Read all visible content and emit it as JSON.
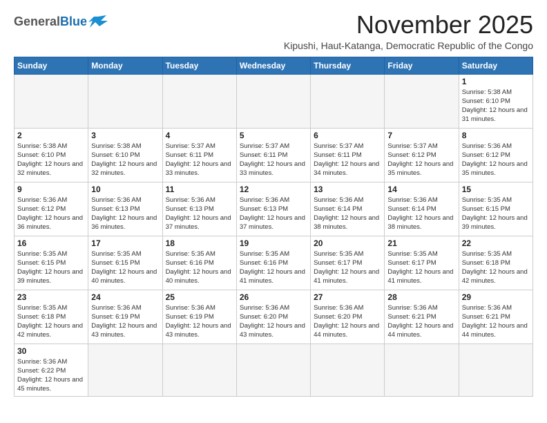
{
  "header": {
    "logo_general": "General",
    "logo_blue": "Blue",
    "month_title": "November 2025",
    "subtitle": "Kipushi, Haut-Katanga, Democratic Republic of the Congo"
  },
  "days_of_week": [
    "Sunday",
    "Monday",
    "Tuesday",
    "Wednesday",
    "Thursday",
    "Friday",
    "Saturday"
  ],
  "weeks": [
    [
      {
        "day": "",
        "info": ""
      },
      {
        "day": "",
        "info": ""
      },
      {
        "day": "",
        "info": ""
      },
      {
        "day": "",
        "info": ""
      },
      {
        "day": "",
        "info": ""
      },
      {
        "day": "",
        "info": ""
      },
      {
        "day": "1",
        "info": "Sunrise: 5:38 AM\nSunset: 6:10 PM\nDaylight: 12 hours and 31 minutes."
      }
    ],
    [
      {
        "day": "2",
        "info": "Sunrise: 5:38 AM\nSunset: 6:10 PM\nDaylight: 12 hours and 32 minutes."
      },
      {
        "day": "3",
        "info": "Sunrise: 5:38 AM\nSunset: 6:10 PM\nDaylight: 12 hours and 32 minutes."
      },
      {
        "day": "4",
        "info": "Sunrise: 5:37 AM\nSunset: 6:11 PM\nDaylight: 12 hours and 33 minutes."
      },
      {
        "day": "5",
        "info": "Sunrise: 5:37 AM\nSunset: 6:11 PM\nDaylight: 12 hours and 33 minutes."
      },
      {
        "day": "6",
        "info": "Sunrise: 5:37 AM\nSunset: 6:11 PM\nDaylight: 12 hours and 34 minutes."
      },
      {
        "day": "7",
        "info": "Sunrise: 5:37 AM\nSunset: 6:12 PM\nDaylight: 12 hours and 35 minutes."
      },
      {
        "day": "8",
        "info": "Sunrise: 5:36 AM\nSunset: 6:12 PM\nDaylight: 12 hours and 35 minutes."
      }
    ],
    [
      {
        "day": "9",
        "info": "Sunrise: 5:36 AM\nSunset: 6:12 PM\nDaylight: 12 hours and 36 minutes."
      },
      {
        "day": "10",
        "info": "Sunrise: 5:36 AM\nSunset: 6:13 PM\nDaylight: 12 hours and 36 minutes."
      },
      {
        "day": "11",
        "info": "Sunrise: 5:36 AM\nSunset: 6:13 PM\nDaylight: 12 hours and 37 minutes."
      },
      {
        "day": "12",
        "info": "Sunrise: 5:36 AM\nSunset: 6:13 PM\nDaylight: 12 hours and 37 minutes."
      },
      {
        "day": "13",
        "info": "Sunrise: 5:36 AM\nSunset: 6:14 PM\nDaylight: 12 hours and 38 minutes."
      },
      {
        "day": "14",
        "info": "Sunrise: 5:36 AM\nSunset: 6:14 PM\nDaylight: 12 hours and 38 minutes."
      },
      {
        "day": "15",
        "info": "Sunrise: 5:35 AM\nSunset: 6:15 PM\nDaylight: 12 hours and 39 minutes."
      }
    ],
    [
      {
        "day": "16",
        "info": "Sunrise: 5:35 AM\nSunset: 6:15 PM\nDaylight: 12 hours and 39 minutes."
      },
      {
        "day": "17",
        "info": "Sunrise: 5:35 AM\nSunset: 6:15 PM\nDaylight: 12 hours and 40 minutes."
      },
      {
        "day": "18",
        "info": "Sunrise: 5:35 AM\nSunset: 6:16 PM\nDaylight: 12 hours and 40 minutes."
      },
      {
        "day": "19",
        "info": "Sunrise: 5:35 AM\nSunset: 6:16 PM\nDaylight: 12 hours and 41 minutes."
      },
      {
        "day": "20",
        "info": "Sunrise: 5:35 AM\nSunset: 6:17 PM\nDaylight: 12 hours and 41 minutes."
      },
      {
        "day": "21",
        "info": "Sunrise: 5:35 AM\nSunset: 6:17 PM\nDaylight: 12 hours and 41 minutes."
      },
      {
        "day": "22",
        "info": "Sunrise: 5:35 AM\nSunset: 6:18 PM\nDaylight: 12 hours and 42 minutes."
      }
    ],
    [
      {
        "day": "23",
        "info": "Sunrise: 5:35 AM\nSunset: 6:18 PM\nDaylight: 12 hours and 42 minutes."
      },
      {
        "day": "24",
        "info": "Sunrise: 5:36 AM\nSunset: 6:19 PM\nDaylight: 12 hours and 43 minutes."
      },
      {
        "day": "25",
        "info": "Sunrise: 5:36 AM\nSunset: 6:19 PM\nDaylight: 12 hours and 43 minutes."
      },
      {
        "day": "26",
        "info": "Sunrise: 5:36 AM\nSunset: 6:20 PM\nDaylight: 12 hours and 43 minutes."
      },
      {
        "day": "27",
        "info": "Sunrise: 5:36 AM\nSunset: 6:20 PM\nDaylight: 12 hours and 44 minutes."
      },
      {
        "day": "28",
        "info": "Sunrise: 5:36 AM\nSunset: 6:21 PM\nDaylight: 12 hours and 44 minutes."
      },
      {
        "day": "29",
        "info": "Sunrise: 5:36 AM\nSunset: 6:21 PM\nDaylight: 12 hours and 44 minutes."
      }
    ],
    [
      {
        "day": "30",
        "info": "Sunrise: 5:36 AM\nSunset: 6:22 PM\nDaylight: 12 hours and 45 minutes."
      },
      {
        "day": "",
        "info": ""
      },
      {
        "day": "",
        "info": ""
      },
      {
        "day": "",
        "info": ""
      },
      {
        "day": "",
        "info": ""
      },
      {
        "day": "",
        "info": ""
      },
      {
        "day": "",
        "info": ""
      }
    ]
  ]
}
